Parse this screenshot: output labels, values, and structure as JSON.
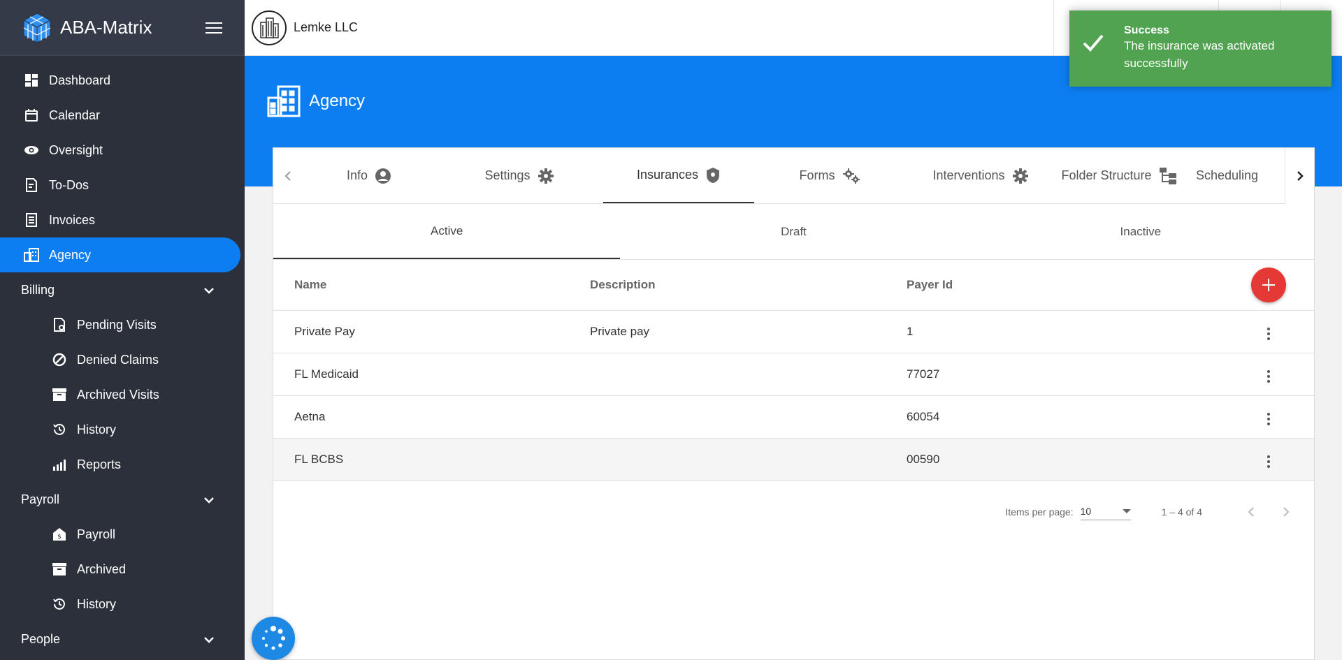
{
  "brand": {
    "name": "ABA-Matrix"
  },
  "sidebar": {
    "items": [
      {
        "label": "Dashboard",
        "icon": "dashboard-icon"
      },
      {
        "label": "Calendar",
        "icon": "calendar-icon"
      },
      {
        "label": "Oversight",
        "icon": "eye-icon"
      },
      {
        "label": "To-Dos",
        "icon": "todo-icon"
      },
      {
        "label": "Invoices",
        "icon": "invoice-icon"
      },
      {
        "label": "Agency",
        "icon": "agency-icon",
        "active": true
      }
    ],
    "billing": {
      "label": "Billing",
      "items": [
        {
          "label": "Pending Visits",
          "icon": "pending-visits-icon"
        },
        {
          "label": "Denied Claims",
          "icon": "denied-icon"
        },
        {
          "label": "Archived Visits",
          "icon": "archive-icon"
        },
        {
          "label": "History",
          "icon": "history-icon"
        },
        {
          "label": "Reports",
          "icon": "reports-icon"
        }
      ]
    },
    "payroll": {
      "label": "Payroll",
      "items": [
        {
          "label": "Payroll",
          "icon": "payroll-icon"
        },
        {
          "label": "Archived",
          "icon": "archive-icon"
        },
        {
          "label": "History",
          "icon": "history-icon"
        }
      ]
    },
    "people": {
      "label": "People"
    }
  },
  "topbar": {
    "org_name": "Lemke LLC"
  },
  "header": {
    "title": "Agency"
  },
  "tabs": [
    {
      "label": "Info",
      "icon": "account-circle-icon"
    },
    {
      "label": "Settings",
      "icon": "gear-icon"
    },
    {
      "label": "Insurances",
      "icon": "shield-icon",
      "selected": true
    },
    {
      "label": "Forms",
      "icon": "gears-icon"
    },
    {
      "label": "Interventions",
      "icon": "gear-icon"
    },
    {
      "label": "Folder Structure",
      "icon": "folder-tree-icon"
    },
    {
      "label": "Scheduling",
      "icon": ""
    }
  ],
  "subtabs": [
    {
      "label": "Active",
      "selected": true
    },
    {
      "label": "Draft"
    },
    {
      "label": "Inactive"
    }
  ],
  "table": {
    "columns": [
      "Name",
      "Description",
      "Payer Id"
    ],
    "rows": [
      {
        "name": "Private Pay",
        "description": "Private pay",
        "payer_id": "1"
      },
      {
        "name": "FL Medicaid",
        "description": "",
        "payer_id": "77027"
      },
      {
        "name": "Aetna",
        "description": "",
        "payer_id": "60054"
      },
      {
        "name": "FL BCBS",
        "description": "",
        "payer_id": "00590"
      }
    ]
  },
  "paginator": {
    "items_per_page_label": "Items per page:",
    "page_size": "10",
    "range": "1 – 4 of 4"
  },
  "toast": {
    "title": "Success",
    "message": "The insurance was activated successfully"
  },
  "colors": {
    "sidebar_bg": "#2b303b",
    "accent": "#0d7ef2",
    "success": "#51a351",
    "add_button": "#e53935"
  }
}
